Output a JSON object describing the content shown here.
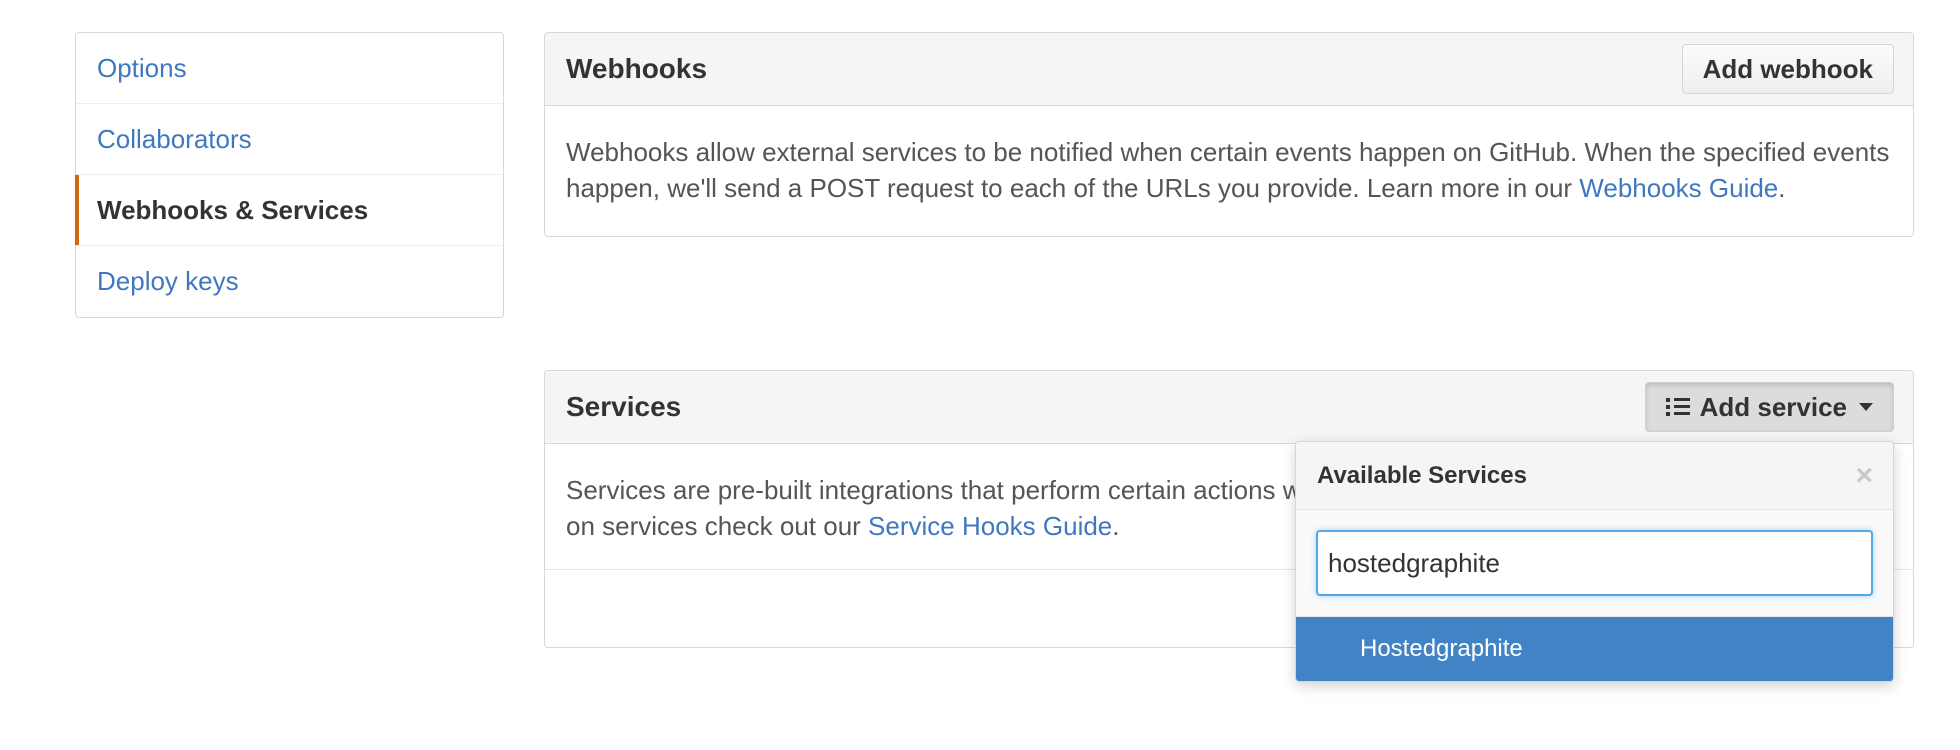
{
  "sidebar": {
    "items": [
      {
        "label": "Options"
      },
      {
        "label": "Collaborators"
      },
      {
        "label": "Webhooks & Services"
      },
      {
        "label": "Deploy keys"
      }
    ]
  },
  "webhooks": {
    "title": "Webhooks",
    "add_button": "Add webhook",
    "description_pre": "Webhooks allow external services to be notified when certain events happen on GitHub. When the specified events happen, we'll send a POST request to each of the URLs you provide. Learn more in our ",
    "guide_link": "Webhooks Guide",
    "description_post": "."
  },
  "services": {
    "title": "Services",
    "add_button": "Add service",
    "description_pre": "Services are pre-built integrations that perform certain actions w",
    "description_line2_pre": "on services check out our ",
    "guide_link": "Service Hooks Guide",
    "description_post": "."
  },
  "dropdown": {
    "title": "Available Services",
    "close": "×",
    "filter_value": "hostedgraphite",
    "results": [
      {
        "label": "Hostedgraphite"
      }
    ]
  },
  "colors": {
    "link": "#4078c0",
    "selected_accent": "#d26911",
    "result_highlight": "#4183c4",
    "focus_border": "#51a7e8"
  }
}
